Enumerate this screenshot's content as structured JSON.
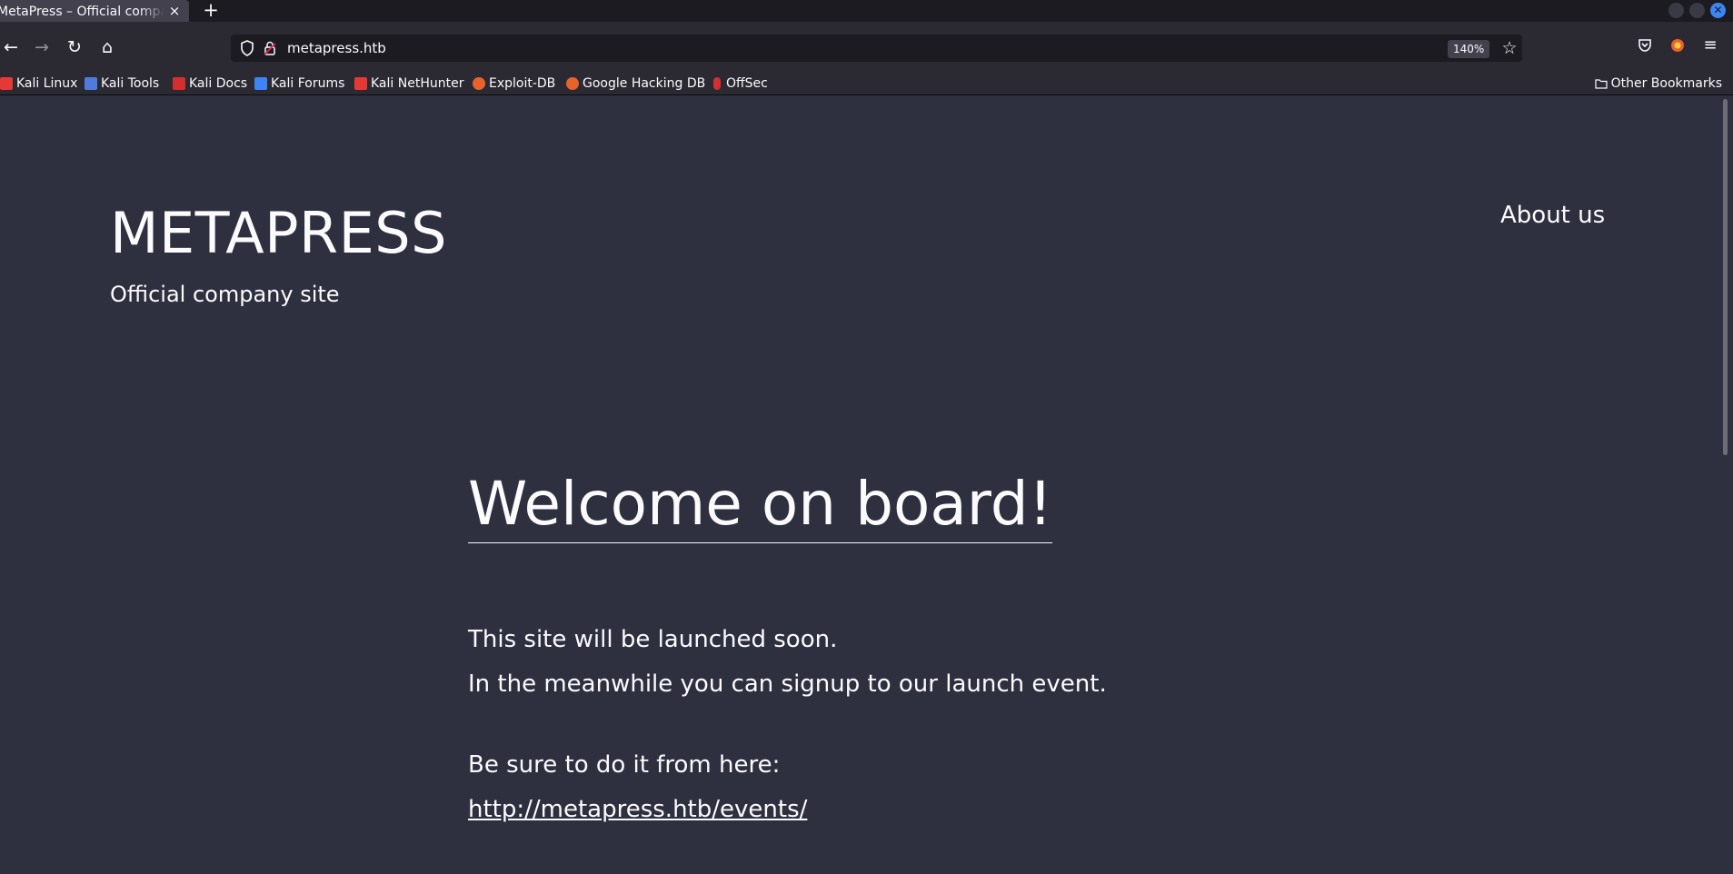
{
  "browser": {
    "tab": {
      "title": "MetaPress – Official company site",
      "close_glyph": "×"
    },
    "new_tab_glyph": "+",
    "nav": {
      "back_glyph": "←",
      "forward_glyph": "→",
      "reload_glyph": "↻",
      "home_glyph": "⌂"
    },
    "url": "metapress.htb",
    "zoom": "140%",
    "star_glyph": "☆",
    "menu_glyph": "≡",
    "bookmarks": [
      {
        "label": "Kali Linux",
        "icon": "kali-dragon-icon",
        "color": "#e53935"
      },
      {
        "label": "Kali Tools",
        "icon": "kali-tools-icon",
        "color": "#4f7bdc"
      },
      {
        "label": "Kali Docs",
        "icon": "kali-docs-icon",
        "color": "#d32f2f"
      },
      {
        "label": "Kali Forums",
        "icon": "kali-forums-icon",
        "color": "#3d84f5"
      },
      {
        "label": "Kali NetHunter",
        "icon": "kali-nethunter-icon",
        "color": "#e53935"
      },
      {
        "label": "Exploit-DB",
        "icon": "exploit-db-icon",
        "color": "#e8632b"
      },
      {
        "label": "Google Hacking DB",
        "icon": "ghdb-icon",
        "color": "#e8632b"
      },
      {
        "label": "OffSec",
        "icon": "offsec-icon",
        "color": "#d32f2f"
      }
    ],
    "other_bookmarks": "Other Bookmarks"
  },
  "site": {
    "title": "METAPRESS",
    "tagline": "Official company site",
    "nav_about": "About us",
    "headline": "Welcome on board!",
    "para1": "This site will be launched soon.",
    "para2": "In the meanwhile you can signup to our launch event.",
    "para3": "Be sure to do it from here:",
    "events_link": "http://metapress.htb/events/"
  },
  "colors": {
    "page_bg": "#2f303f",
    "text": "#fbfbfe",
    "toolbar_bg": "#2b2a33",
    "tabstrip_bg": "#1c1b22"
  }
}
